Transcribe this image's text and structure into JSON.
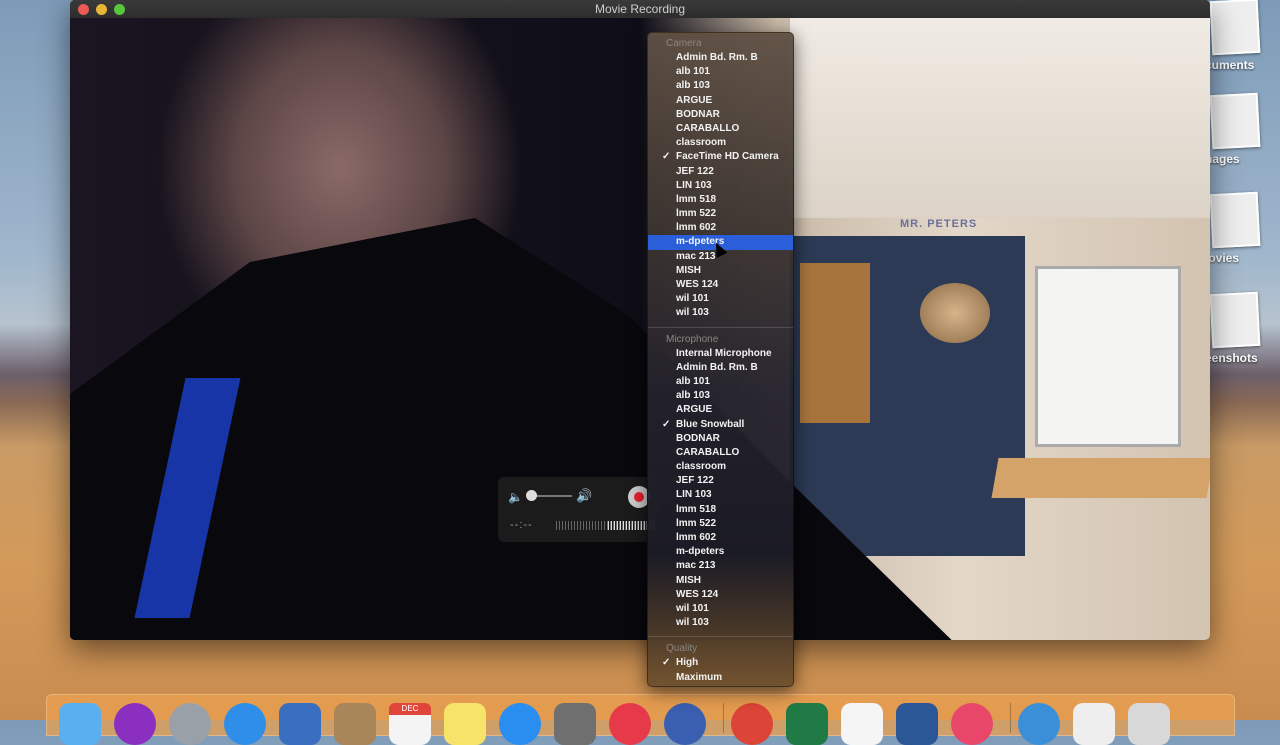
{
  "window": {
    "title": "Movie Recording"
  },
  "desktop_stacks": [
    {
      "label": "Documents",
      "visible_label": "cuments"
    },
    {
      "label": "Images",
      "visible_label": "nages"
    },
    {
      "label": "Movies",
      "visible_label": "lovies"
    },
    {
      "label": "Screenshots",
      "visible_label": "eenshots"
    }
  ],
  "video": {
    "wall_sign": "MR. PETERS"
  },
  "controls": {
    "time": "--:--",
    "volume": 0.0,
    "recording": false
  },
  "menu": {
    "sections": [
      {
        "header": "Camera",
        "items": [
          {
            "label": "Admin Bd. Rm. B",
            "checked": false,
            "highlighted": false
          },
          {
            "label": "alb 101",
            "checked": false,
            "highlighted": false
          },
          {
            "label": "alb 103",
            "checked": false,
            "highlighted": false
          },
          {
            "label": "ARGUE",
            "checked": false,
            "highlighted": false
          },
          {
            "label": "BODNAR",
            "checked": false,
            "highlighted": false
          },
          {
            "label": "CARABALLO",
            "checked": false,
            "highlighted": false
          },
          {
            "label": "classroom",
            "checked": false,
            "highlighted": false
          },
          {
            "label": "FaceTime HD Camera",
            "checked": true,
            "highlighted": false
          },
          {
            "label": "JEF 122",
            "checked": false,
            "highlighted": false
          },
          {
            "label": "LIN 103",
            "checked": false,
            "highlighted": false
          },
          {
            "label": "lmm 518",
            "checked": false,
            "highlighted": false
          },
          {
            "label": "lmm 522",
            "checked": false,
            "highlighted": false
          },
          {
            "label": "lmm 602",
            "checked": false,
            "highlighted": false
          },
          {
            "label": "m-dpeters",
            "checked": false,
            "highlighted": true
          },
          {
            "label": "mac 213",
            "checked": false,
            "highlighted": false
          },
          {
            "label": "MISH",
            "checked": false,
            "highlighted": false
          },
          {
            "label": "WES 124",
            "checked": false,
            "highlighted": false
          },
          {
            "label": "wil 101",
            "checked": false,
            "highlighted": false
          },
          {
            "label": "wil 103",
            "checked": false,
            "highlighted": false
          }
        ]
      },
      {
        "header": "Microphone",
        "items": [
          {
            "label": "Internal Microphone",
            "checked": false,
            "highlighted": false
          },
          {
            "label": "Admin Bd. Rm. B",
            "checked": false,
            "highlighted": false
          },
          {
            "label": "alb 101",
            "checked": false,
            "highlighted": false
          },
          {
            "label": "alb 103",
            "checked": false,
            "highlighted": false
          },
          {
            "label": "ARGUE",
            "checked": false,
            "highlighted": false
          },
          {
            "label": "Blue Snowball",
            "checked": true,
            "highlighted": false
          },
          {
            "label": "BODNAR",
            "checked": false,
            "highlighted": false
          },
          {
            "label": "CARABALLO",
            "checked": false,
            "highlighted": false
          },
          {
            "label": "classroom",
            "checked": false,
            "highlighted": false
          },
          {
            "label": "JEF 122",
            "checked": false,
            "highlighted": false
          },
          {
            "label": "LIN 103",
            "checked": false,
            "highlighted": false
          },
          {
            "label": "lmm 518",
            "checked": false,
            "highlighted": false
          },
          {
            "label": "lmm 522",
            "checked": false,
            "highlighted": false
          },
          {
            "label": "lmm 602",
            "checked": false,
            "highlighted": false
          },
          {
            "label": "m-dpeters",
            "checked": false,
            "highlighted": false
          },
          {
            "label": "mac 213",
            "checked": false,
            "highlighted": false
          },
          {
            "label": "MISH",
            "checked": false,
            "highlighted": false
          },
          {
            "label": "WES 124",
            "checked": false,
            "highlighted": false
          },
          {
            "label": "wil 101",
            "checked": false,
            "highlighted": false
          },
          {
            "label": "wil 103",
            "checked": false,
            "highlighted": false
          }
        ]
      },
      {
        "header": "Quality",
        "items": [
          {
            "label": "High",
            "checked": true,
            "highlighted": false
          },
          {
            "label": "Maximum",
            "checked": false,
            "highlighted": false
          }
        ]
      }
    ],
    "check_glyph": "✓",
    "highlight_color": "#2b5fd9"
  },
  "dock": {
    "calendar_month": "DEC",
    "apps": [
      {
        "name": "finder",
        "color": "#5ab0ef"
      },
      {
        "name": "siri",
        "color": "#8a2fbf"
      },
      {
        "name": "launchpad",
        "color": "#9aa0a8"
      },
      {
        "name": "safari",
        "color": "#2f8fe8"
      },
      {
        "name": "mail",
        "color": "#3a6fc0"
      },
      {
        "name": "contacts",
        "color": "#a8865a"
      },
      {
        "name": "calendar",
        "color": "#f4f4f4"
      },
      {
        "name": "notes",
        "color": "#f7e36a"
      },
      {
        "name": "app-store",
        "color": "#2a8ef0"
      },
      {
        "name": "system-preferences",
        "color": "#6f6f6f"
      },
      {
        "name": "news",
        "color": "#e63a4a"
      },
      {
        "name": "quicktime",
        "color": "#3a5fb0"
      },
      {
        "name": "chrome",
        "color": "#db4437"
      },
      {
        "name": "excel",
        "color": "#1f7a45"
      },
      {
        "name": "onenote-terminal",
        "color": "#f5f5f5"
      },
      {
        "name": "word",
        "color": "#2b5797"
      },
      {
        "name": "itunes",
        "color": "#e8476a"
      },
      {
        "name": "network",
        "color": "#3a8fd8"
      },
      {
        "name": "preview-window",
        "color": "#eeeeee"
      },
      {
        "name": "trash",
        "color": "#d8d8d8"
      }
    ]
  }
}
